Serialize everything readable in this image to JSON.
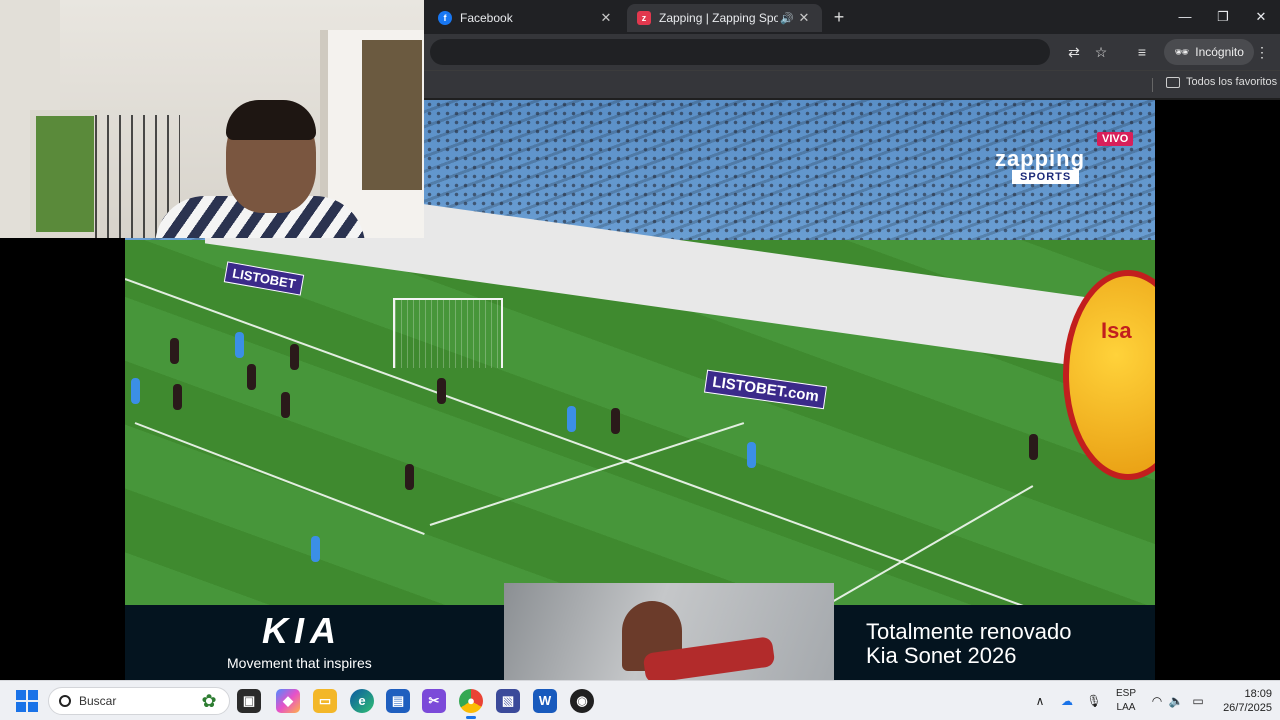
{
  "browser": {
    "tabs": [
      {
        "title": "Facebook",
        "favicon": "facebook-icon"
      },
      {
        "title": "Zapping | Zapping Sports",
        "favicon": "zapping-icon",
        "audio": true
      }
    ],
    "new_tab_glyph": "+",
    "window_controls": {
      "minimize": "—",
      "maximize": "❐",
      "close": "✕"
    },
    "incognito_label": "Incógnito",
    "bookmarks_folder": "Todos los favoritos"
  },
  "video": {
    "live_badge": "VIVO",
    "brand_name": "zapping",
    "brand_sub": "SPORTS",
    "ad_board_1": "LISTOBET",
    "ad_board_2": "LISTOBET.com",
    "balloon_text": "Isa"
  },
  "banner": {
    "logo": "KIA",
    "tagline": "Movement that inspires",
    "headline_line1": "Totalmente renovado",
    "headline_line2": "Kia Sonet 2026"
  },
  "taskbar": {
    "search_placeholder": "Buscar",
    "language_line1": "ESP",
    "language_line2": "LAA",
    "time": "18:09",
    "date": "26/7/2025"
  },
  "colors": {
    "chrome_dark": "#202124",
    "chrome_toolbar": "#35363a",
    "live_red": "#d81f5a",
    "taskbar_bg": "#eef0f4",
    "accent_blue": "#1a73e8"
  }
}
